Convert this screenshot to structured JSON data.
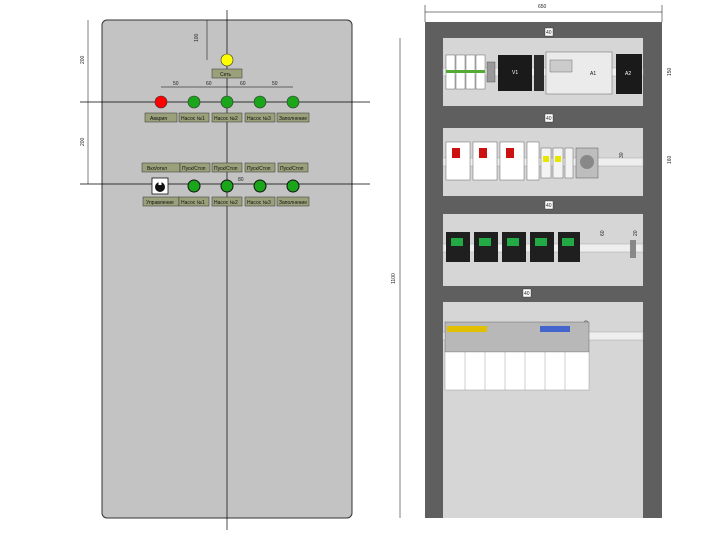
{
  "front": {
    "indicators": [
      {
        "color": "#ffff00",
        "label": "Сеть"
      },
      {
        "color": "#ff0000",
        "label": "Авария"
      },
      {
        "color": "#1aa51a",
        "label": "Насос №1"
      },
      {
        "color": "#1aa51a",
        "label": "Насос №2"
      },
      {
        "color": "#1aa51a",
        "label": "Насос №3"
      },
      {
        "color": "#1aa51a",
        "label": "Заполнение"
      }
    ],
    "buttons_top_labels": [
      "Вкл/откл",
      "Пуск/Стоп",
      "Пуск/Стоп",
      "Пуск/Стоп",
      "Пуск/Стоп"
    ],
    "buttons_bottom_labels": [
      "Управление",
      "Насос №1",
      "Насос №2",
      "Насос №3",
      "Заполнение"
    ],
    "dims": {
      "top": "100",
      "left_upper": "200",
      "left_lower": "200",
      "s1": "50",
      "s2": "60",
      "s3": "60",
      "s4": "50",
      "row2_center": "80"
    }
  },
  "back": {
    "dims": {
      "width": "650",
      "height": "1100",
      "rail_gap1": "40",
      "rail_gap2": "40",
      "rail_gap3": "40",
      "rail_gap4": "40",
      "right_1": "150",
      "right_2": "160",
      "right_3": "30",
      "right_4": "60",
      "right_5": "20",
      "right_6": "10"
    },
    "components": {
      "a1": "A1",
      "a2": "A2",
      "v1": "V1"
    }
  }
}
